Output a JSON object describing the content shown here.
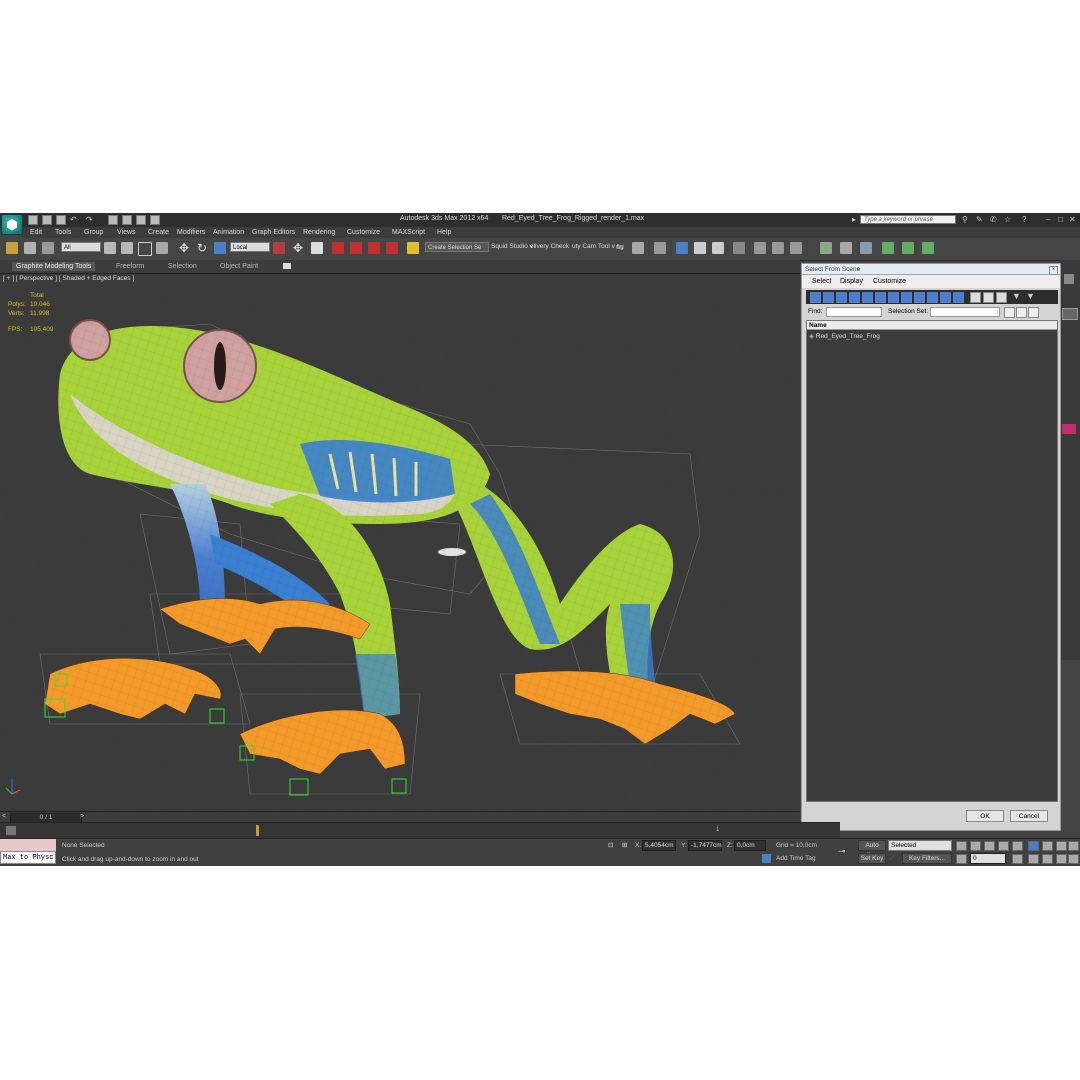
{
  "app": {
    "title": "Autodesk 3ds Max  2012 x64",
    "filename": "Red_Eyed_Tree_Frog_Rigged_render_1.max",
    "search_placeholder": "Type a keyword or phrase",
    "logo": "3ds-max-logo"
  },
  "menu": [
    "Edit",
    "Tools",
    "Group",
    "Views",
    "Create",
    "Modifiers",
    "Animation",
    "Graph Editors",
    "Rendering",
    "Customize",
    "MAXScript",
    "Help"
  ],
  "toolbar": {
    "selection_filter": "All",
    "coord_system": "Local",
    "named_selection": "Create Selection Se",
    "squid_label": "Squid Studio v",
    "delivery_label": "elivery Check",
    "cam_label": "uty Cam Tool v"
  },
  "ribbon": {
    "tabs": [
      "Graphite Modeling Tools",
      "Freeform",
      "Selection",
      "Object Paint"
    ]
  },
  "viewport": {
    "label": "[ + ] [ Perspective ] [ Shaded + Edged Faces ]",
    "stats": {
      "total_label": "Total",
      "polys_label": "Polys:",
      "polys": "19.046",
      "verts_label": "Verts:",
      "verts": "11.998",
      "fps_label": "FPS:",
      "fps": "105,409"
    }
  },
  "select_dialog": {
    "title": "Select From Scene",
    "menu": [
      "Select",
      "Display",
      "Customize"
    ],
    "find_label": "Find:",
    "selection_set_label": "Selection Set:",
    "column_header": "Name",
    "items": [
      "Red_Eyed_Tree_Frog"
    ],
    "ok_label": "OK",
    "cancel_label": "Cancel"
  },
  "timeline": {
    "frame": "0 / 1",
    "tick_label": "1"
  },
  "status": {
    "script_listener": "Max to Physc",
    "selection": "None Selected",
    "prompt": "Click and drag up-and-down to zoom in and out",
    "x_label": "X:",
    "x": "5,4054cm",
    "y_label": "Y:",
    "y": "-1,7477cm",
    "z_label": "Z:",
    "z": "0,0cm",
    "grid": "Grid = 10,0cm",
    "add_time_tag": "Add Time Tag",
    "auto_key": "Auto Key",
    "auto_key_mode": "Selected",
    "set_key": "Set Key",
    "key_filters": "Key Filters...",
    "frame_field": "0"
  },
  "colors": {
    "frog_green": "#a8d23a",
    "frog_blue": "#3a7fd0",
    "frog_orange": "#f39a2a",
    "viewport_bg": "#3b3b3b",
    "stats_yellow": "#e0c020"
  }
}
